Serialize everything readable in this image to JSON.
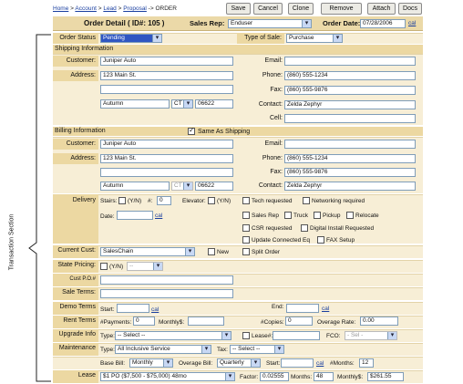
{
  "breadcrumb": [
    "Home",
    "Account",
    "Lead",
    "Proposal",
    "ORDER"
  ],
  "toolbar": {
    "save": "Save",
    "cancel": "Cancel",
    "clone": "Clone",
    "remove": "Remove",
    "attach": "Attach",
    "docs": "Docs"
  },
  "header": {
    "title": "Order Detail ( ID#: 105 )",
    "sales_rep_label": "Sales Rep:",
    "sales_rep": "Enduser",
    "order_date_label": "Order Date:",
    "order_date": "07/28/2006",
    "cal": "cal"
  },
  "order_status": {
    "label": "Order Status",
    "value": "Pending",
    "type_label": "Type of Sale:",
    "type_value": "Purchase"
  },
  "shipping": {
    "title": "Shipping Information",
    "customer_label": "Customer:",
    "customer": "Juniper Auto",
    "address_label": "Address:",
    "address1": "123 Main St.",
    "address2": "",
    "city": "Autumn",
    "state": "CT",
    "zip": "06622",
    "email_label": "Email:",
    "email": "",
    "phone_label": "Phone:",
    "phone": "(860) 555-1234",
    "fax_label": "Fax:",
    "fax": "(860) 555-9876",
    "contact_label": "Contact:",
    "contact": "Zelda Zephyr",
    "cell_label": "Cell:",
    "cell": ""
  },
  "billing": {
    "title": "Billing Information",
    "same_label": "Same As Shipping",
    "customer_label": "Customer:",
    "customer": "Juniper Auto",
    "address_label": "Address:",
    "address1": "123 Main St.",
    "address2": "",
    "city": "Autumn",
    "state": "CT",
    "zip": "06622",
    "email_label": "Email:",
    "email": "",
    "phone_label": "Phone:",
    "phone": "(860) 555-1234",
    "fax_label": "Fax:",
    "fax": "(860) 555-9876",
    "contact_label": "Contact:",
    "contact": "Zelda Zephyr"
  },
  "delivery": {
    "label": "Delivery",
    "stairs": "Stairs:",
    "yn": "(Y/N)",
    "num": "#:",
    "num_val": "0",
    "elevator": "Elevator:",
    "date": "Date:",
    "cal": "cal",
    "opts": [
      "Tech requested",
      "Networking required",
      "Sales Rep",
      "Truck",
      "Pickup",
      "Relocate",
      "CSR requested",
      "Digital Install Requested",
      "Update Connected Eq",
      "FAX Setup",
      "Split Order"
    ]
  },
  "current_cust": {
    "label": "Current Cust:",
    "value": "SalesChain",
    "new": "New"
  },
  "state_pricing": {
    "label": "State Pricing:",
    "yn": "(Y/N)",
    "sel": "--"
  },
  "cust_po": {
    "label": "Cust P.O.#"
  },
  "sale_terms": {
    "label": "Sale Terms:"
  },
  "demo_terms": {
    "label": "Demo Terms",
    "start": "Start:",
    "end": "End:",
    "cal": "cal"
  },
  "rent_terms": {
    "label": "Rent Terms",
    "payments": "#Payments:",
    "payments_val": "0",
    "monthly": "Monthly$:",
    "copies": "#Copies:",
    "copies_val": "0",
    "overage": "Overage Rate:",
    "overage_val": "0.00"
  },
  "upgrade": {
    "label": "Upgrade Info",
    "type": "Type:",
    "type_val": "-- Select --",
    "lease": "Lease#:",
    "fco": "FCO:",
    "fco_val": "- Sel -"
  },
  "maintenance": {
    "label": "Maintenance",
    "type": "Type:",
    "type_val": "All Inclusive Service",
    "tax": "Tax:",
    "tax_val": "-- Select --",
    "base_bill": "Base Bill:",
    "base_val": "Monthly",
    "overage_bill": "Overage Bill:",
    "overage_val": "Quarterly",
    "start": "Start:",
    "cal": "cal",
    "months": "#Months:",
    "months_val": "12"
  },
  "lease": {
    "label": "Lease",
    "value": "$1 PO ($7,500 - $75,000) 48mo",
    "factor": "Factor:",
    "factor_val": "0.02555",
    "months": "Months:",
    "months_val": "48",
    "monthly": "Monthly$:",
    "monthly_val": "$261.55"
  },
  "side_label": "Transaction Section"
}
